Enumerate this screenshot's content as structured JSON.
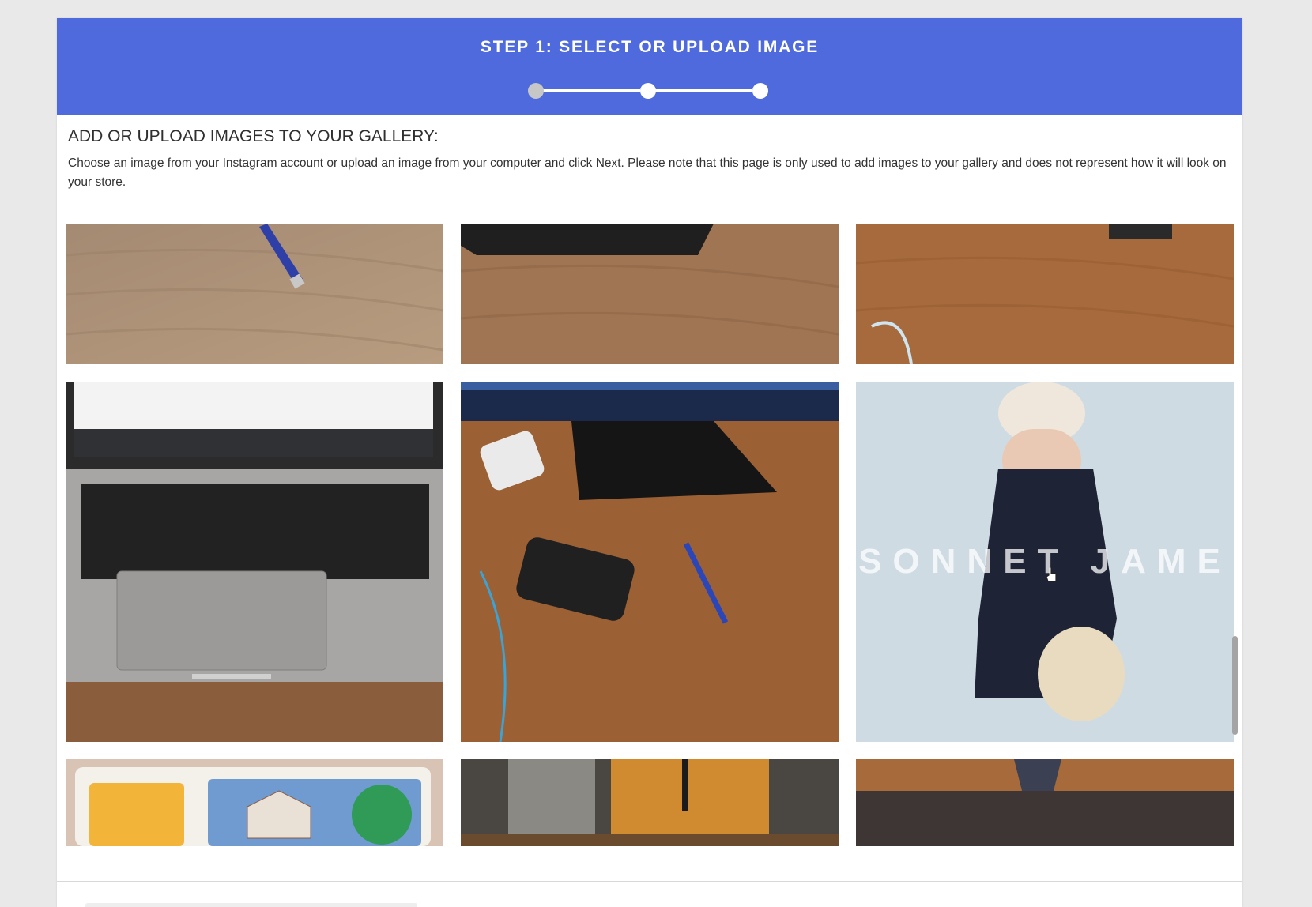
{
  "header": {
    "title": "STEP 1: SELECT OR UPLOAD IMAGE",
    "progress": {
      "total_steps": 3,
      "current_step": 1
    }
  },
  "content": {
    "title": "ADD OR UPLOAD IMAGES TO YOUR GALLERY:",
    "description": "Choose an image from your Instagram account or upload an image from your computer and click Next. Please note that this page is only used to add images to your gallery and does not represent how it will look on your store."
  },
  "gallery": {
    "images": [
      {
        "subject": "blue pen on wooden desk",
        "caption": ""
      },
      {
        "subject": "dark device edge on wooden desk",
        "caption": ""
      },
      {
        "subject": "cable on wooden desk",
        "caption": ""
      },
      {
        "subject": "laptop keyboard on desk",
        "caption": ""
      },
      {
        "subject": "monitor, power bank and pen on desk",
        "caption": ""
      },
      {
        "subject": "woman in polka dot dress with straw bag",
        "caption": "SONNET JAME"
      },
      {
        "subject": "Touch & Tell toy",
        "caption": ""
      },
      {
        "subject": "glasses of iced tea",
        "caption": ""
      },
      {
        "subject": "dark stand on wooden desk",
        "caption": ""
      }
    ]
  },
  "colors": {
    "header_bg": "#4f6adc",
    "page_bg": "#e9e9e9",
    "panel_bg": "#ffffff",
    "wood": "#a8825c"
  }
}
